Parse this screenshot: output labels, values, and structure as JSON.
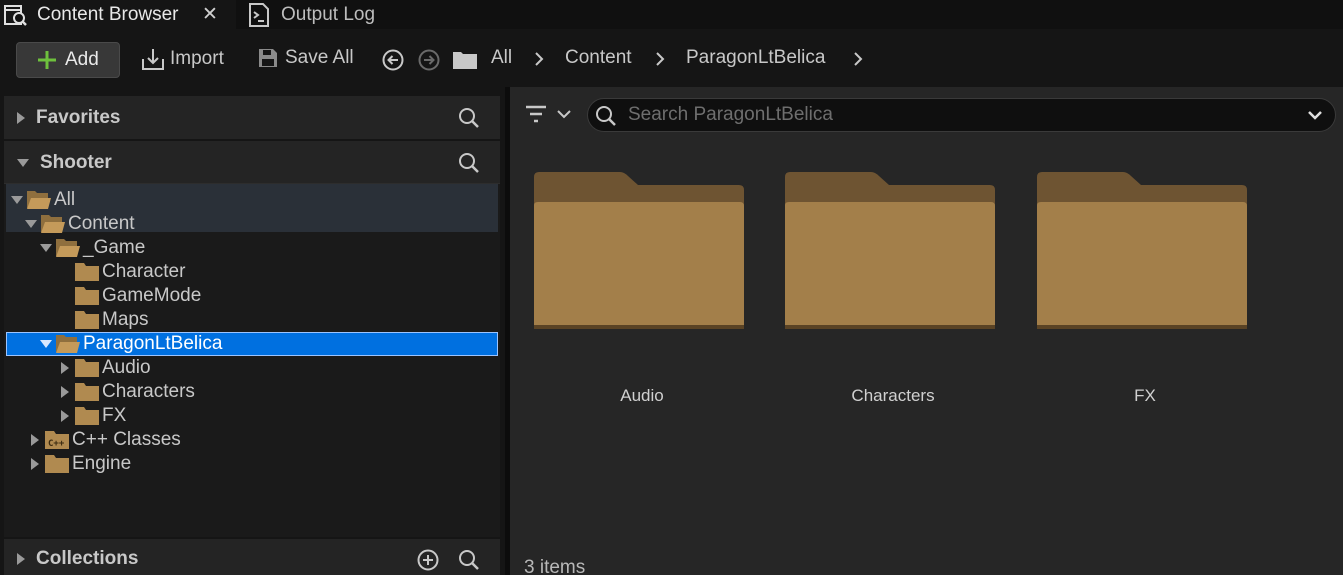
{
  "tabs": [
    {
      "label": "Content Browser",
      "icon": "content-browser-icon",
      "close": "✕"
    },
    {
      "label": "Output Log",
      "icon": "output-log-icon"
    }
  ],
  "toolbar": {
    "add_label": "Add",
    "import_label": "Import",
    "save_all_label": "Save All",
    "breadcrumbs": [
      "All",
      "Content",
      "ParagonLtBelica"
    ]
  },
  "left_panel": {
    "favorites_label": "Favorites",
    "project_label": "Shooter",
    "collections_label": "Collections",
    "tree": [
      {
        "label": "All",
        "depth": 0,
        "expanded": true
      },
      {
        "label": "Content",
        "depth": 1,
        "expanded": true
      },
      {
        "label": "_Game",
        "depth": 2,
        "expanded": true
      },
      {
        "label": "Character",
        "depth": 3
      },
      {
        "label": "GameMode",
        "depth": 3
      },
      {
        "label": "Maps",
        "depth": 3
      },
      {
        "label": "ParagonLtBelica",
        "depth": 2,
        "expanded": true,
        "selected": true
      },
      {
        "label": "Audio",
        "depth": 3,
        "collapsed": true
      },
      {
        "label": "Characters",
        "depth": 3,
        "collapsed": true
      },
      {
        "label": "FX",
        "depth": 3,
        "collapsed": true
      },
      {
        "label": "C++ Classes",
        "depth": 1,
        "collapsed": true
      },
      {
        "label": "Engine",
        "depth": 1,
        "collapsed": true
      }
    ]
  },
  "asset_view": {
    "search_placeholder": "Search ParagonLtBelica",
    "folders": [
      "Audio",
      "Characters",
      "FX"
    ],
    "item_count": "3 items"
  },
  "colors": {
    "selection": "#0070e0",
    "folder": "#a37f4a",
    "add_icon": "#6ec13d"
  }
}
